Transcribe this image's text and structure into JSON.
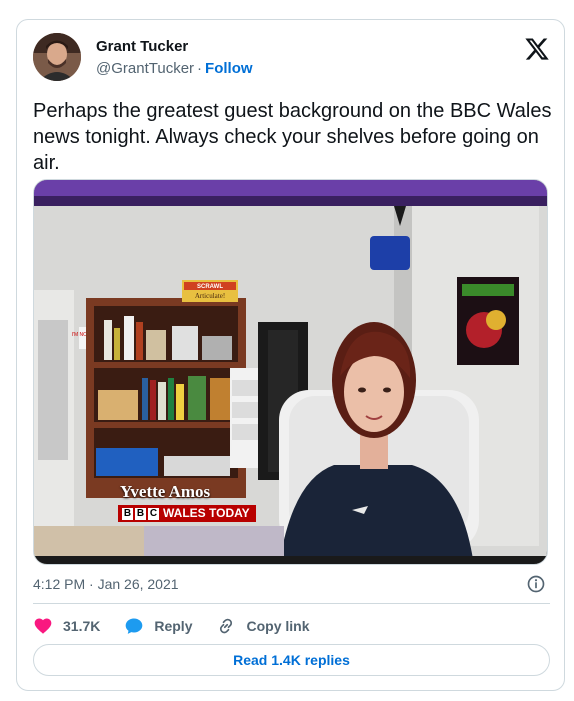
{
  "author": {
    "name": "Grant Tucker",
    "handle": "@GrantTucker",
    "separator": "·",
    "follow_label": "Follow",
    "avatar_icon": "profile-photo"
  },
  "platform_icon": "x-logo-icon",
  "tweet": {
    "text": "Perhaps the greatest guest background on the BBC Wales news tonight. Always check your shelves before going on air."
  },
  "media": {
    "caption_name": "Yvette Amos",
    "caption_channel_logo": "BBC",
    "caption_channel": "WALES TODAY",
    "box_text_top": "SCRAWL",
    "box_text_mid": "Articulate!",
    "sign_text": "I'M NOT HAPPY"
  },
  "meta": {
    "timestamp": "4:12 PM · Jan 26, 2021"
  },
  "actions": {
    "likes_count": "31.7K",
    "reply_label": "Reply",
    "copy_link_label": "Copy link"
  },
  "replies_button": "Read 1.4K replies",
  "colors": {
    "accent": "#006fd6",
    "like": "#f91880",
    "reply": "#1d9bf0",
    "muted": "#536471",
    "border": "#cfd9de",
    "bbc_red": "#b80000"
  }
}
